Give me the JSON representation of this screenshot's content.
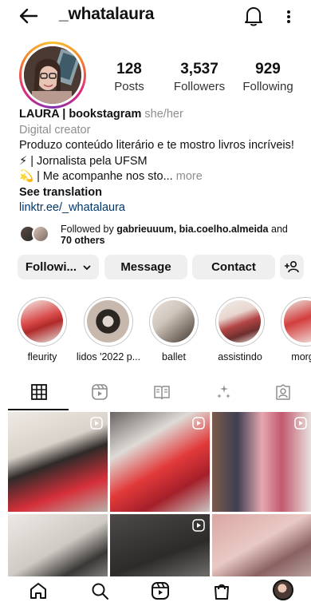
{
  "header": {
    "username": "_whatalaura",
    "back_icon": "back-arrow-icon",
    "bell_icon": "bell-icon",
    "more_icon": "more-vertical-icon"
  },
  "stats": [
    {
      "value": "128",
      "label": "Posts"
    },
    {
      "value": "3,537",
      "label": "Followers"
    },
    {
      "value": "929",
      "label": "Following"
    }
  ],
  "bio": {
    "name": "LAURA | bookstagram",
    "pronouns": "she/her",
    "category": "Digital creator",
    "line1": "Produzo conteúdo literário e te mostro livros incríveis!",
    "line2": "⚡ | Jornalista pela UFSM",
    "line3": "💫 | Me acompanhe nos sto",
    "ellipsis": "...",
    "more": "more",
    "see_translation": "See translation",
    "link": "linktr.ee/_whatalaura"
  },
  "followed_by": {
    "prefix": "Followed by ",
    "names": "gabrieuuum, bia.coelho.almeida",
    "middle": " and ",
    "others": "70 others"
  },
  "buttons": {
    "following": "Followi...",
    "message": "Message",
    "contact": "Contact"
  },
  "highlights": [
    {
      "label": "fleurity"
    },
    {
      "label": "lidos '2022 p..."
    },
    {
      "label": "ballet"
    },
    {
      "label": "assistindo"
    },
    {
      "label": "morga"
    }
  ],
  "colors": {
    "link": "#00376b",
    "muted": "#8e8e8e",
    "button_bg": "#efefef"
  }
}
